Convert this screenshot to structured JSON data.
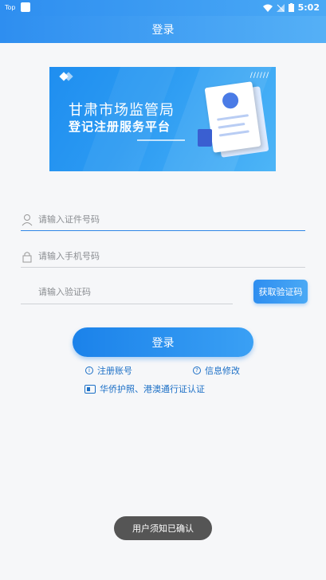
{
  "status_bar": {
    "left_label": "Top",
    "time": "5:02"
  },
  "title": "登录",
  "banner": {
    "line1": "甘肃市场监管局",
    "line2": "登记注册服务平台",
    "decor": "//////"
  },
  "form": {
    "id_placeholder": "请输入证件号码",
    "phone_placeholder": "请输入手机号码",
    "code_placeholder": "请输入验证码",
    "get_code_label": "获取验证码"
  },
  "login_label": "登录",
  "links": {
    "register": "注册账号",
    "modify_info": "信息修改",
    "passport_auth": "华侨护照、港澳通行证认证"
  },
  "toast": "用户须知已确认",
  "colors": {
    "primary": "#2e8ef0",
    "link": "#1b6fc6"
  }
}
